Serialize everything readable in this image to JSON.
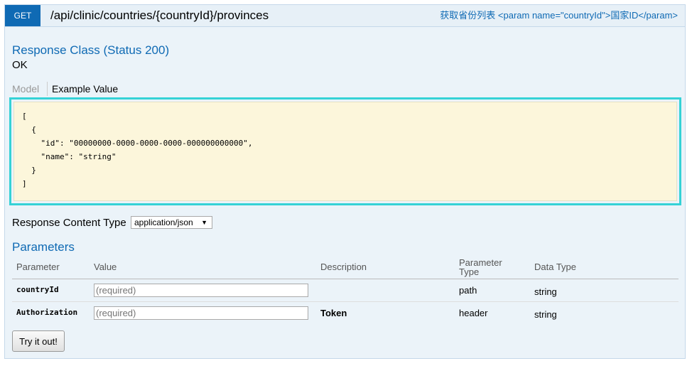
{
  "operation": {
    "method": "GET",
    "path": "/api/clinic/countries/{countryId}/provinces",
    "summary": "获取省份列表 <param name=\"countryId\">国家ID</param>"
  },
  "response": {
    "class_title": "Response Class (Status 200)",
    "status_text": "OK",
    "tabs": {
      "model": "Model",
      "example": "Example Value"
    },
    "example_lines": [
      "[",
      "  {",
      "    \"id\": \"00000000-0000-0000-0000-000000000000\",",
      "    \"name\": \"string\"",
      "  }",
      "]"
    ],
    "content_type_label": "Response Content Type",
    "content_type_value": "application/json"
  },
  "parameters": {
    "title": "Parameters",
    "headers": {
      "parameter": "Parameter",
      "value": "Value",
      "description": "Description",
      "parameter_type": "Parameter Type",
      "data_type": "Data Type"
    },
    "rows": [
      {
        "name": "countryId",
        "placeholder": "(required)",
        "description": "",
        "param_type": "path",
        "data_type": "string"
      },
      {
        "name": "Authorization",
        "placeholder": "(required)",
        "description": "Token",
        "param_type": "header",
        "data_type": "string"
      }
    ]
  },
  "try_button": "Try it out!",
  "colors": {
    "method_bg": "#0f6ab4",
    "panel_bg": "#ebf3f9",
    "code_bg": "#fcf6db",
    "highlight_border": "#35d2d6",
    "link_blue": "#0f6ab4"
  }
}
